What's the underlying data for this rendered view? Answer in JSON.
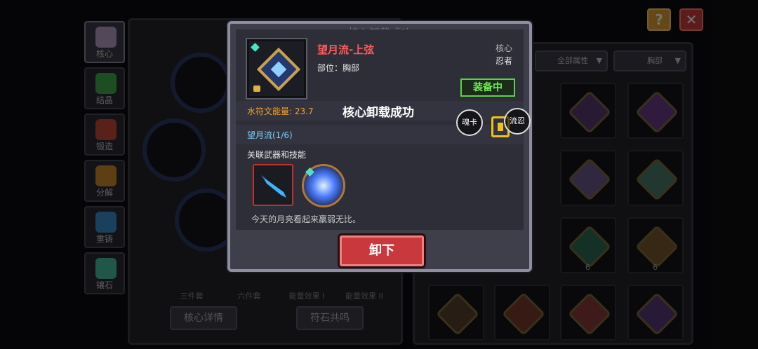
{
  "modal": {
    "ghost_title": "核心卸载成功",
    "item_name": "望月流-上弦",
    "part_label": "部位：胸部",
    "type_label": "核心",
    "class_label": "忍者",
    "equip_tag": "装备中",
    "energy_text": "水符文能量: 23.7",
    "toast_text": "核心卸载成功",
    "set_name": "望月流(1/6)",
    "related_label": "关联武器和技能",
    "description": "今天的月亮看起来羸弱无比。",
    "unload_button": "卸下",
    "float_soul_card": "魂卡",
    "float_ninja": "流忍"
  },
  "sidebar": {
    "items": [
      {
        "label": "核心",
        "icon": "core-icon"
      },
      {
        "label": "结晶",
        "icon": "crystal-icon"
      },
      {
        "label": "锻造",
        "icon": "forge-icon"
      },
      {
        "label": "分解",
        "icon": "disassemble-icon"
      },
      {
        "label": "重铸",
        "icon": "recast-icon"
      },
      {
        "label": "镶石",
        "icon": "inlay-icon"
      }
    ]
  },
  "bottom": {
    "tabs": [
      "三件套",
      "六件套",
      "能量效果 I",
      "能量效果 II"
    ],
    "core_detail_button": "核心详情",
    "rune_resonance_button": "符石共鸣"
  },
  "filters": {
    "attribute": "全部属性",
    "part": "胸部"
  },
  "topbar": {
    "help": "?",
    "close": "✕"
  },
  "grid": {
    "levels": [
      "6",
      "6"
    ]
  },
  "colors": {
    "item_name": "#ff5a5a",
    "equip_tag": "#6ff04f",
    "energy": "#f0a030",
    "set_name": "#7fcfff",
    "unload_button": "#c8383c"
  }
}
